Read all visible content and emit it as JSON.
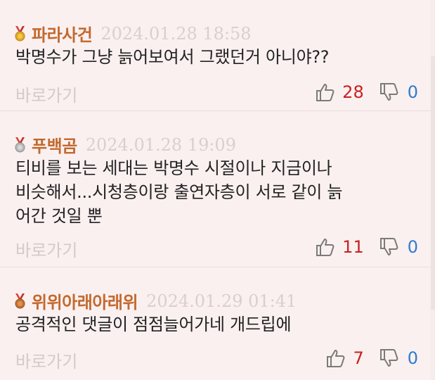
{
  "comments": [
    {
      "nickname": "파라사건",
      "medal": "gold-medal-icon",
      "date": "2024.01.28 18:58",
      "lines": [
        "박명수가 그냥 늙어보여서 그랬던거 아니야??"
      ],
      "reply_label": "바로가기",
      "likes": "28",
      "dislikes": "0"
    },
    {
      "nickname": "푸백곰",
      "medal": "silver-medal-icon",
      "date": "2024.01.28 19:09",
      "lines": [
        "티비를 보는 세대는 박명수 시절이나 지금이나",
        "비슷해서...시청층이랑 출연자층이 서로 같이 늙",
        "어간 것일 뿐"
      ],
      "reply_label": "바로가기",
      "likes": "11",
      "dislikes": "0"
    },
    {
      "nickname": "위위아래아래위",
      "medal": "bronze-medal-icon",
      "date": "2024.01.29 01:41",
      "lines": [
        "공격적인 댓글이 점점늘어가네 개드립에"
      ],
      "reply_label": "바로가기",
      "likes": "7",
      "dislikes": "0"
    }
  ],
  "colors": {
    "background": "#fbf0f0",
    "nickname": "#c2692e",
    "date": "#d9cfcf",
    "like_count": "#c8211f",
    "dislike_count": "#2e7dcc",
    "gold": "#e0a922",
    "silver": "#b8b8b8",
    "bronze": "#c4702f",
    "ribbon": "#d9473f"
  }
}
